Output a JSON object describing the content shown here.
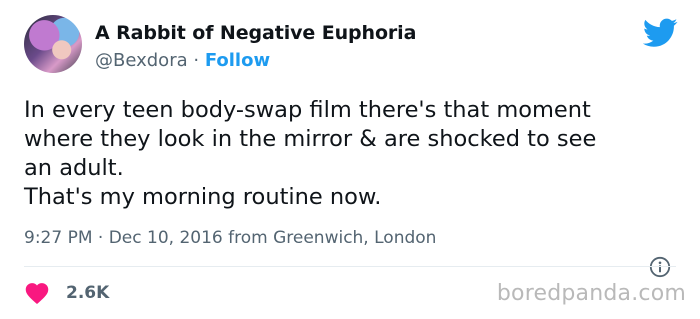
{
  "user": {
    "display_name": "A Rabbit of Negative Euphoria",
    "handle": "@Bexdora",
    "separator": " · ",
    "follow_label": "Follow"
  },
  "tweet": {
    "lines": [
      "In every teen body-swap film there's that moment",
      "where they look in the mirror & are shocked to see",
      "an adult.",
      "That's my morning routine now."
    ],
    "meta": "9:27 PM · Dec 10, 2016 from Greenwich, London",
    "like_count": "2.6K"
  },
  "icons": {
    "logo": "twitter-bird-icon",
    "info": "info-icon",
    "like": "heart-icon"
  },
  "colors": {
    "brand_blue": "#1d9bf0",
    "heart_red": "#f91880",
    "secondary_text": "#536471",
    "watermark": "#b9b9b9"
  },
  "watermark": "boredpanda.com"
}
